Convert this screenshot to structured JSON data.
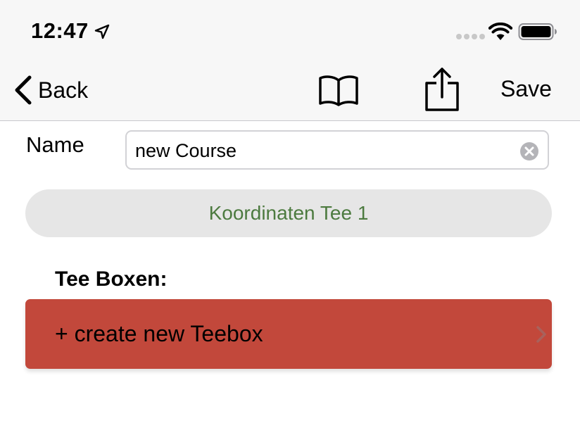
{
  "status_bar": {
    "time": "12:47",
    "location_icon": "location-arrow-icon",
    "wifi_icon": "wifi-icon",
    "battery_icon": "battery-icon"
  },
  "nav_bar": {
    "back_label": "Back",
    "book_icon": "book-icon",
    "share_icon": "share-icon",
    "save_label": "Save"
  },
  "form": {
    "name_label": "Name",
    "name_value": "new Course",
    "coordinates_button_label": "Koordinaten Tee 1"
  },
  "teeboxes": {
    "section_title": "Tee Boxen:",
    "create_label": "+ create new Teebox"
  },
  "colors": {
    "coordinates_text": "#4c7a3f",
    "create_row_background": "#c2483b",
    "coordinates_button_background": "#e6e6e6",
    "bar_background": "#f7f7f7"
  }
}
